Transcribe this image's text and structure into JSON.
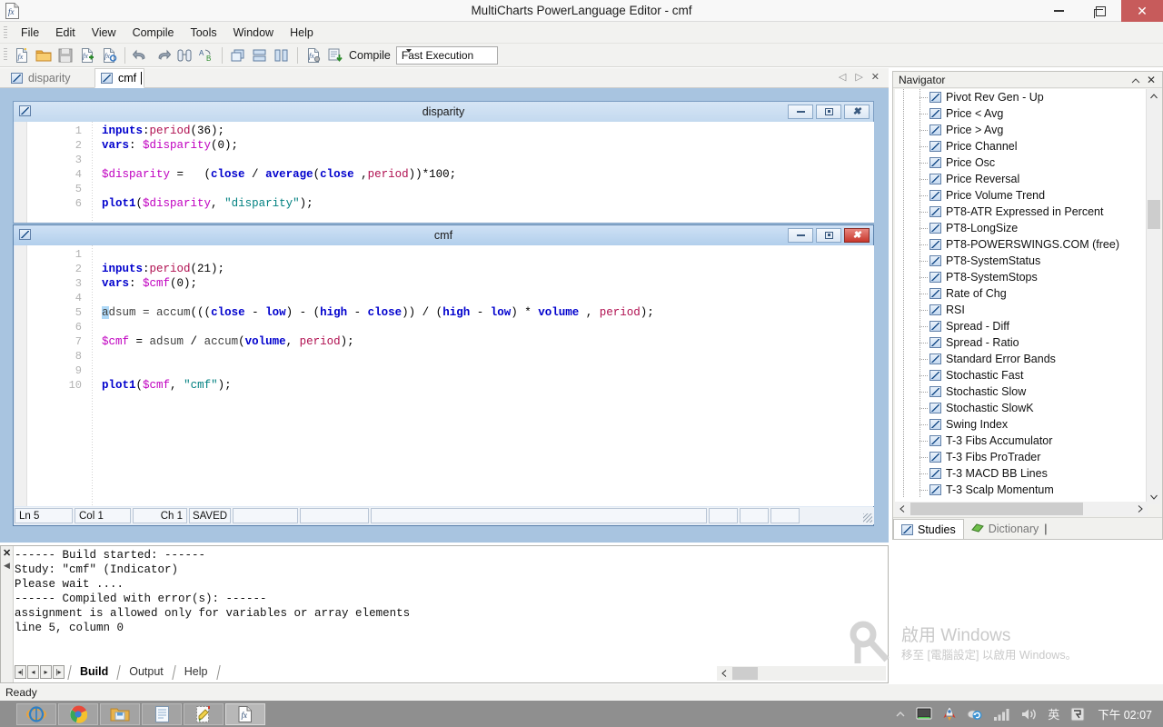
{
  "window": {
    "title": "MultiCharts PowerLanguage Editor - cmf",
    "icon": "function-fx-icon",
    "controls": {
      "minimize": "–",
      "maximize": "❐",
      "close": "✕"
    }
  },
  "menubar": {
    "items": [
      {
        "label": "File",
        "name": "menu-file"
      },
      {
        "label": "Edit",
        "name": "menu-edit"
      },
      {
        "label": "View",
        "name": "menu-view"
      },
      {
        "label": "Compile",
        "name": "menu-compile"
      },
      {
        "label": "Tools",
        "name": "menu-tools"
      },
      {
        "label": "Window",
        "name": "menu-window"
      },
      {
        "label": "Help",
        "name": "menu-help"
      }
    ]
  },
  "toolbar": {
    "compile_label": "Compile",
    "execution_mode": "Fast Execution",
    "buttons": [
      {
        "name": "new-study-button",
        "icon": "new-study-icon"
      },
      {
        "name": "open-button",
        "icon": "open-folder-icon"
      },
      {
        "name": "save-button",
        "icon": "save-icon"
      },
      {
        "name": "import-study-button",
        "icon": "import-study-icon"
      },
      {
        "name": "export-study-button",
        "icon": "export-study-icon"
      },
      {
        "name": "undo-button",
        "icon": "undo-arrow-icon"
      },
      {
        "name": "redo-button",
        "icon": "redo-arrow-icon"
      },
      {
        "name": "find-button",
        "icon": "binoculars-icon"
      },
      {
        "name": "replace-button",
        "icon": "replace-ab-icon"
      },
      {
        "name": "cascade-windows-button",
        "icon": "cascade-icon"
      },
      {
        "name": "tile-horizontal-button",
        "icon": "tile-horizontal-icon"
      },
      {
        "name": "tile-vertical-button",
        "icon": "tile-vertical-icon"
      },
      {
        "name": "compile-settings-button",
        "icon": "compile-settings-icon"
      },
      {
        "name": "compile-all-button",
        "icon": "compile-all-icon"
      }
    ]
  },
  "doc_tabs": {
    "tabs": [
      {
        "label": "disparity",
        "active": false,
        "icon": "study-icon"
      },
      {
        "label": "cmf",
        "active": true,
        "icon": "study-icon"
      }
    ],
    "nav": {
      "prev": "◁",
      "next": "▷",
      "close": "✕"
    }
  },
  "editors": [
    {
      "name": "disparity",
      "title": "disparity",
      "active": false,
      "lines": [
        {
          "num": "1",
          "tokens": [
            {
              "t": "inputs",
              "c": "k"
            },
            {
              "t": ":",
              "c": "n"
            },
            {
              "t": "period",
              "c": "p"
            },
            {
              "t": "(36);",
              "c": "n"
            }
          ]
        },
        {
          "num": "2",
          "tokens": [
            {
              "t": "vars",
              "c": "k"
            },
            {
              "t": ": ",
              "c": "n"
            },
            {
              "t": "$disparity",
              "c": "v"
            },
            {
              "t": "(0);",
              "c": "n"
            }
          ]
        },
        {
          "num": "3",
          "tokens": []
        },
        {
          "num": "4",
          "tokens": [
            {
              "t": "$disparity",
              "c": "v"
            },
            {
              "t": " =   (",
              "c": "n"
            },
            {
              "t": "close",
              "c": "k"
            },
            {
              "t": " / ",
              "c": "n"
            },
            {
              "t": "average",
              "c": "k"
            },
            {
              "t": "(",
              "c": "n"
            },
            {
              "t": "close",
              "c": "k"
            },
            {
              "t": " ,",
              "c": "n"
            },
            {
              "t": "period",
              "c": "p"
            },
            {
              "t": "))*100;",
              "c": "n"
            }
          ]
        },
        {
          "num": "5",
          "tokens": []
        },
        {
          "num": "6",
          "tokens": [
            {
              "t": "plot1",
              "c": "k"
            },
            {
              "t": "(",
              "c": "n"
            },
            {
              "t": "$disparity",
              "c": "v"
            },
            {
              "t": ", ",
              "c": "n"
            },
            {
              "t": "\"disparity\"",
              "c": "s"
            },
            {
              "t": ");",
              "c": "n"
            }
          ]
        }
      ]
    },
    {
      "name": "cmf",
      "title": "cmf",
      "active": true,
      "lines": [
        {
          "num": "1",
          "tokens": []
        },
        {
          "num": "2",
          "tokens": [
            {
              "t": "inputs",
              "c": "k"
            },
            {
              "t": ":",
              "c": "n"
            },
            {
              "t": "period",
              "c": "p"
            },
            {
              "t": "(21);",
              "c": "n"
            }
          ]
        },
        {
          "num": "3",
          "tokens": [
            {
              "t": "vars",
              "c": "k"
            },
            {
              "t": ": ",
              "c": "n"
            },
            {
              "t": "$cmf",
              "c": "v"
            },
            {
              "t": "(0);",
              "c": "n"
            }
          ]
        },
        {
          "num": "4",
          "tokens": []
        },
        {
          "num": "5",
          "tokens": [
            {
              "t": "a",
              "c": "g sel"
            },
            {
              "t": "dsum = ",
              "c": "g"
            },
            {
              "t": "accum",
              "c": "g"
            },
            {
              "t": "(((",
              "c": "n"
            },
            {
              "t": "close",
              "c": "k"
            },
            {
              "t": " - ",
              "c": "n"
            },
            {
              "t": "low",
              "c": "k"
            },
            {
              "t": ") - (",
              "c": "n"
            },
            {
              "t": "high",
              "c": "k"
            },
            {
              "t": " - ",
              "c": "n"
            },
            {
              "t": "close",
              "c": "k"
            },
            {
              "t": ")) / (",
              "c": "n"
            },
            {
              "t": "high",
              "c": "k"
            },
            {
              "t": " - ",
              "c": "n"
            },
            {
              "t": "low",
              "c": "k"
            },
            {
              "t": ") * ",
              "c": "n"
            },
            {
              "t": "volume",
              "c": "k"
            },
            {
              "t": " , ",
              "c": "n"
            },
            {
              "t": "period",
              "c": "p"
            },
            {
              "t": ");",
              "c": "n"
            }
          ]
        },
        {
          "num": "6",
          "tokens": []
        },
        {
          "num": "7",
          "tokens": [
            {
              "t": "$cmf",
              "c": "v"
            },
            {
              "t": " = ",
              "c": "n"
            },
            {
              "t": "adsum",
              "c": "g"
            },
            {
              "t": " / ",
              "c": "n"
            },
            {
              "t": "accum",
              "c": "g"
            },
            {
              "t": "(",
              "c": "n"
            },
            {
              "t": "volume",
              "c": "k"
            },
            {
              "t": ", ",
              "c": "n"
            },
            {
              "t": "period",
              "c": "p"
            },
            {
              "t": ");",
              "c": "n"
            }
          ]
        },
        {
          "num": "8",
          "tokens": []
        },
        {
          "num": "9",
          "tokens": []
        },
        {
          "num": "10",
          "tokens": [
            {
              "t": "plot1",
              "c": "k"
            },
            {
              "t": "(",
              "c": "n"
            },
            {
              "t": "$cmf",
              "c": "v"
            },
            {
              "t": ", ",
              "c": "n"
            },
            {
              "t": "\"cmf\"",
              "c": "s"
            },
            {
              "t": ");",
              "c": "n"
            }
          ]
        }
      ],
      "status": {
        "line": "Ln 5",
        "col": "Col 1",
        "ch": "Ch 1",
        "saved": "SAVED"
      }
    }
  ],
  "navigator": {
    "title": "Navigator",
    "close_icon": "✕",
    "items": [
      "Pivot Rev Gen - Up",
      "Price < Avg",
      "Price > Avg",
      "Price Channel",
      "Price Osc",
      "Price Reversal",
      "Price Volume Trend",
      "PT8-ATR Expressed in Percent",
      "PT8-LongSize",
      "PT8-POWERSWINGS.COM (free)",
      "PT8-SystemStatus",
      "PT8-SystemStops",
      "Rate of Chg",
      "RSI",
      "Spread - Diff",
      "Spread - Ratio",
      "Standard Error Bands",
      "Stochastic Fast",
      "Stochastic Slow",
      "Stochastic SlowK",
      "Swing Index",
      "T-3 Fibs Accumulator",
      "T-3 Fibs ProTrader",
      "T-3 MACD BB Lines",
      "T-3 Scalp Momentum"
    ],
    "tabs": [
      {
        "label": "Studies",
        "active": true,
        "icon": "study-icon"
      },
      {
        "label": "Dictionary",
        "active": false,
        "icon": "dictionary-icon"
      }
    ]
  },
  "output": {
    "lines": [
      "------ Build started: ------",
      "Study: \"cmf\" (Indicator)",
      "Please wait ....",
      "------ Compiled with error(s): ------",
      "assignment is allowed only for variables or array elements",
      "line 5, column 0"
    ],
    "tabs": [
      {
        "label": "Build",
        "active": true
      },
      {
        "label": "Output",
        "active": false
      },
      {
        "label": "Help",
        "active": false
      }
    ],
    "close_icon": "✕"
  },
  "status_bar": {
    "text": "Ready"
  },
  "watermark": {
    "title": "啟用 Windows",
    "subtitle": "移至 [電腦設定] 以啟用 Windows。",
    "icon": "key-icon"
  },
  "taskbar": {
    "buttons": [
      {
        "name": "taskbar-internet-explorer",
        "icon": "internet-explorer-icon",
        "active": false
      },
      {
        "name": "taskbar-chrome",
        "icon": "chrome-icon",
        "active": false
      },
      {
        "name": "taskbar-file-explorer",
        "icon": "folder-icon",
        "active": false
      },
      {
        "name": "taskbar-notepad",
        "icon": "notepad-icon",
        "active": false
      },
      {
        "name": "taskbar-editor-doc",
        "icon": "edit-document-icon",
        "active": false
      },
      {
        "name": "taskbar-powerlanguage-editor",
        "icon": "function-fx-icon",
        "active": true
      }
    ],
    "tray": {
      "show_hidden": "▲",
      "icons": [
        {
          "name": "monitor-icon"
        },
        {
          "name": "rocket-icon"
        },
        {
          "name": "network-sync-icon"
        },
        {
          "name": "signal-bars-icon"
        },
        {
          "name": "volume-icon"
        },
        {
          "name": "ime-chinese-icon",
          "label": "英"
        },
        {
          "name": "ime-mode-icon"
        }
      ],
      "clock": "下午 02:07"
    }
  },
  "colors": {
    "keyword": "#0000cd",
    "variable": "#c000c0",
    "param": "#b01050",
    "string": "#008080",
    "mdi_background": "#a8c4e0",
    "close_red": "#c75b5b"
  }
}
